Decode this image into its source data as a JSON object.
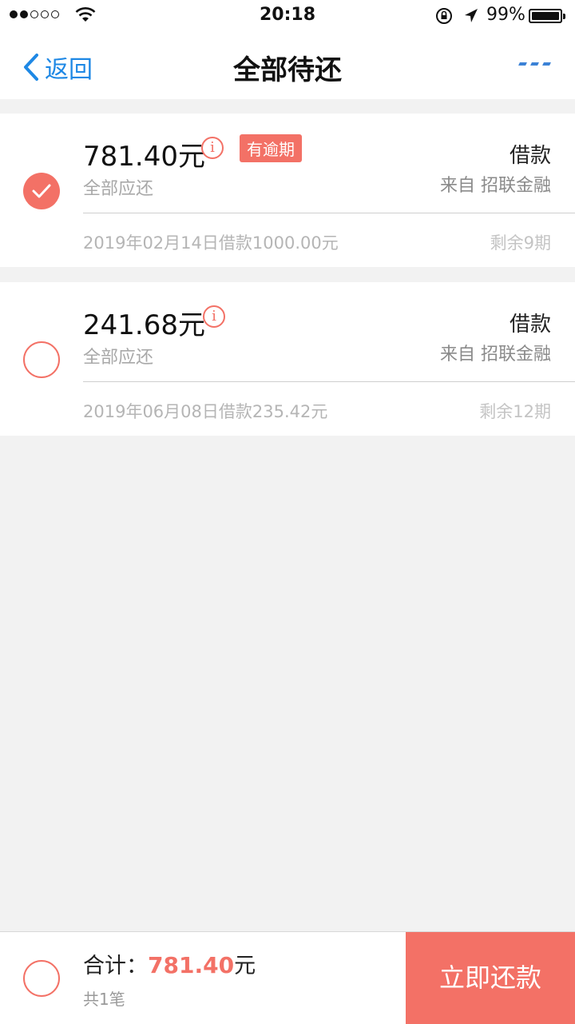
{
  "status": {
    "time": "20:18",
    "battery": "99%",
    "signal_strength": 2
  },
  "nav": {
    "back_label": "返回",
    "title": "全部待还",
    "more_icon": "ellipsis-icon"
  },
  "loans": [
    {
      "amount": "781.40元",
      "badge": "有逾期",
      "amount_label": "全部应还",
      "type": "借款",
      "from": "来自 招联金融",
      "detail": "2019年02月14日借款1000.00元",
      "remaining": "剩余9期",
      "selected": true
    },
    {
      "amount": "241.68元",
      "amount_label": "全部应还",
      "type": "借款",
      "from": "来自 招联金融",
      "detail": "2019年06月08日借款235.42元",
      "remaining": "剩余12期",
      "selected": false
    }
  ],
  "footer": {
    "total_label": "合计：",
    "total_amount": "781.40",
    "total_unit": "元",
    "count": "共1笔",
    "pay_button": "立即还款"
  },
  "colors": {
    "accent": "#f37166",
    "link_blue": "#1e88e5",
    "background": "#f2f2f2"
  }
}
